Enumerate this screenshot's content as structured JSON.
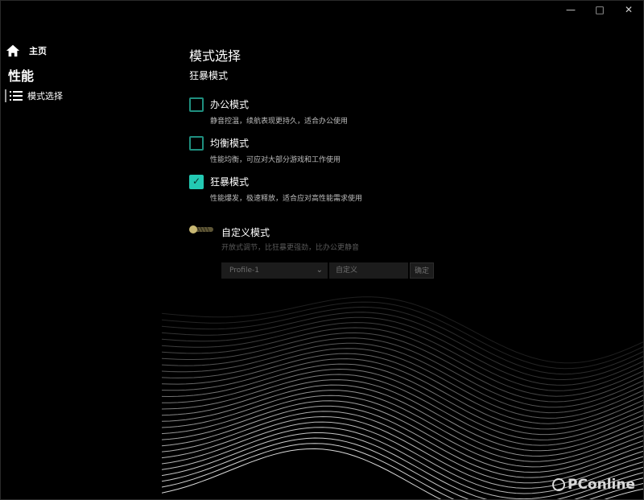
{
  "sidebar": {
    "home_label": "主页",
    "section_title": "性能",
    "nav_items": [
      {
        "label": "模式选择",
        "icon": "list-icon"
      }
    ]
  },
  "main": {
    "title": "模式选择",
    "current_mode": "狂暴模式",
    "options": [
      {
        "label": "办公模式",
        "desc": "静音控温，续航表现更持久，适合办公使用",
        "checked": false
      },
      {
        "label": "均衡模式",
        "desc": "性能均衡，可应对大部分游戏和工作使用",
        "checked": false
      },
      {
        "label": "狂暴模式",
        "desc": "性能爆发，极速释放，适合应对高性能需求使用",
        "checked": true
      }
    ],
    "custom": {
      "label": "自定义模式",
      "desc": "开放式调节，比狂暴更强劲，比办公更静音",
      "enabled": false,
      "profile_value": "Profile-1",
      "name_value": "自定义",
      "confirm_label": "确定"
    }
  },
  "watermark": "PConline",
  "colors": {
    "accent": "#23c9b3",
    "toggle": "#c8b873",
    "background": "#000000"
  }
}
